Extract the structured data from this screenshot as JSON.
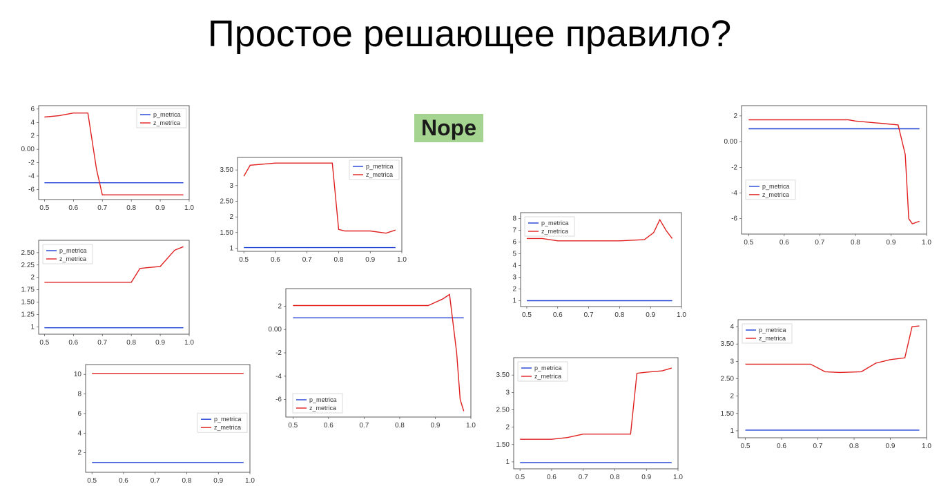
{
  "title": "Простое решающее правило?",
  "nope": "Nope",
  "legend": {
    "p": "p_metrica",
    "z": "z_metrica"
  },
  "x_ticks": [
    0.5,
    0.6,
    0.7,
    0.8,
    0.9,
    1.0
  ],
  "chart_data": [
    {
      "id": "c1",
      "type": "line",
      "pos": [
        12,
        145,
        270,
        170
      ],
      "x": [
        0.5,
        0.55,
        0.6,
        0.65,
        0.68,
        0.7,
        0.72,
        0.8,
        0.9,
        0.98
      ],
      "series": [
        {
          "name": "p_metrica",
          "values": [
            -5.0,
            -5.0,
            -5.0,
            -5.0,
            -5.0,
            -5.0,
            -5.0,
            -5.0,
            -5.0,
            -5.0
          ]
        },
        {
          "name": "z_metrica",
          "values": [
            4.8,
            5.0,
            5.4,
            5.4,
            -3.0,
            -6.8,
            -6.8,
            -6.8,
            -6.8,
            -6.8
          ]
        }
      ],
      "ylim": [
        -7.5,
        6.5
      ],
      "yticks": [
        -6,
        -4,
        -2,
        0,
        2,
        4,
        6
      ],
      "legend_pos": "top-right-inside"
    },
    {
      "id": "c2",
      "type": "line",
      "pos": [
        12,
        340,
        270,
        170
      ],
      "x": [
        0.5,
        0.6,
        0.7,
        0.75,
        0.8,
        0.83,
        0.86,
        0.9,
        0.95,
        0.98
      ],
      "series": [
        {
          "name": "p_metrica",
          "values": [
            0.98,
            0.98,
            0.98,
            0.98,
            0.98,
            0.98,
            0.98,
            0.98,
            0.98,
            0.98
          ]
        },
        {
          "name": "z_metrica",
          "values": [
            1.9,
            1.9,
            1.9,
            1.9,
            1.9,
            2.18,
            2.2,
            2.22,
            2.55,
            2.62
          ]
        }
      ],
      "ylim": [
        0.85,
        2.75
      ],
      "yticks": [
        1.0,
        1.25,
        1.5,
        1.75,
        2.0,
        2.25,
        2.5
      ],
      "legend_pos": "top-left"
    },
    {
      "id": "c3",
      "type": "line",
      "pos": [
        80,
        520,
        290,
        190
      ],
      "x": [
        0.5,
        0.6,
        0.7,
        0.8,
        0.9,
        0.98
      ],
      "series": [
        {
          "name": "p_metrica",
          "values": [
            1.0,
            1.0,
            1.0,
            1.0,
            1.0,
            1.0
          ]
        },
        {
          "name": "z_metrica",
          "values": [
            10.1,
            10.1,
            10.1,
            10.1,
            10.1,
            10.1
          ]
        }
      ],
      "ylim": [
        0,
        11
      ],
      "yticks": [
        2,
        4,
        6,
        8,
        10
      ],
      "legend_pos": "right-mid"
    },
    {
      "id": "c4",
      "type": "line",
      "pos": [
        300,
        220,
        290,
        170
      ],
      "x": [
        0.5,
        0.52,
        0.6,
        0.7,
        0.78,
        0.8,
        0.82,
        0.9,
        0.95,
        0.98
      ],
      "series": [
        {
          "name": "p_metrica",
          "values": [
            1.02,
            1.02,
            1.02,
            1.02,
            1.02,
            1.02,
            1.02,
            1.02,
            1.02,
            1.02
          ]
        },
        {
          "name": "z_metrica",
          "values": [
            3.3,
            3.65,
            3.72,
            3.72,
            3.72,
            1.6,
            1.55,
            1.55,
            1.48,
            1.58
          ]
        }
      ],
      "ylim": [
        0.9,
        3.9
      ],
      "yticks": [
        1.0,
        1.5,
        2.0,
        2.5,
        3.0,
        3.5
      ],
      "legend_pos": "top-right-inside"
    },
    {
      "id": "c5",
      "type": "line",
      "pos": [
        370,
        410,
        320,
        220
      ],
      "x": [
        0.5,
        0.6,
        0.7,
        0.8,
        0.88,
        0.92,
        0.94,
        0.96,
        0.97,
        0.98
      ],
      "series": [
        {
          "name": "p_metrica",
          "values": [
            1.0,
            1.0,
            1.0,
            1.0,
            1.0,
            1.0,
            1.0,
            1.0,
            1.0,
            1.0
          ]
        },
        {
          "name": "z_metrica",
          "values": [
            2.05,
            2.05,
            2.05,
            2.05,
            2.05,
            2.6,
            3.0,
            -2.0,
            -6.0,
            -7.0
          ]
        }
      ],
      "ylim": [
        -7.5,
        3.5
      ],
      "yticks": [
        -6,
        -4,
        -2,
        0,
        2
      ],
      "legend_pos": "bottom-left"
    },
    {
      "id": "c6",
      "type": "line",
      "pos": [
        710,
        300,
        285,
        170
      ],
      "x": [
        0.5,
        0.55,
        0.6,
        0.7,
        0.8,
        0.88,
        0.91,
        0.93,
        0.95,
        0.97
      ],
      "series": [
        {
          "name": "p_metrica",
          "values": [
            1.0,
            1.0,
            1.0,
            1.0,
            1.0,
            1.0,
            1.0,
            1.0,
            1.0,
            1.0
          ]
        },
        {
          "name": "z_metrica",
          "values": [
            6.3,
            6.3,
            6.1,
            6.1,
            6.1,
            6.2,
            6.8,
            7.9,
            7.0,
            6.3
          ]
        }
      ],
      "ylim": [
        0.5,
        8.5
      ],
      "yticks": [
        1,
        2,
        3,
        4,
        5,
        6,
        7,
        8
      ],
      "legend_pos": "top-left"
    },
    {
      "id": "c7",
      "type": "line",
      "pos": [
        700,
        510,
        290,
        195
      ],
      "x": [
        0.5,
        0.6,
        0.65,
        0.7,
        0.8,
        0.85,
        0.87,
        0.9,
        0.95,
        0.98
      ],
      "series": [
        {
          "name": "p_metrica",
          "values": [
            0.98,
            0.98,
            0.98,
            0.98,
            0.98,
            0.98,
            0.98,
            0.98,
            0.98,
            0.98
          ]
        },
        {
          "name": "z_metrica",
          "values": [
            1.65,
            1.65,
            1.7,
            1.8,
            1.8,
            1.8,
            3.55,
            3.58,
            3.62,
            3.7
          ]
        }
      ],
      "ylim": [
        0.8,
        4.0
      ],
      "yticks": [
        1.0,
        1.5,
        2.0,
        2.5,
        3.0,
        3.5
      ],
      "legend_pos": "top-left"
    },
    {
      "id": "c8",
      "type": "line",
      "pos": [
        1030,
        145,
        320,
        220
      ],
      "x": [
        0.5,
        0.6,
        0.7,
        0.78,
        0.8,
        0.88,
        0.92,
        0.94,
        0.95,
        0.96,
        0.98
      ],
      "series": [
        {
          "name": "p_metrica",
          "values": [
            1.0,
            1.0,
            1.0,
            1.0,
            1.0,
            1.0,
            1.0,
            1.0,
            1.0,
            1.0,
            1.0
          ]
        },
        {
          "name": "z_metrica",
          "values": [
            1.7,
            1.7,
            1.7,
            1.7,
            1.6,
            1.4,
            1.3,
            -1.0,
            -6.0,
            -6.4,
            -6.2
          ]
        }
      ],
      "ylim": [
        -7.2,
        2.8
      ],
      "yticks": [
        -6,
        -4,
        -2,
        0,
        2
      ],
      "legend_pos": "left-mid"
    },
    {
      "id": "c9",
      "type": "line",
      "pos": [
        1025,
        455,
        325,
        205
      ],
      "x": [
        0.5,
        0.6,
        0.68,
        0.72,
        0.76,
        0.82,
        0.86,
        0.9,
        0.94,
        0.96,
        0.98
      ],
      "series": [
        {
          "name": "p_metrica",
          "values": [
            1.02,
            1.02,
            1.02,
            1.02,
            1.02,
            1.02,
            1.02,
            1.02,
            1.02,
            1.02,
            1.02
          ]
        },
        {
          "name": "z_metrica",
          "values": [
            2.92,
            2.92,
            2.92,
            2.7,
            2.68,
            2.7,
            2.95,
            3.05,
            3.1,
            4.0,
            4.02
          ]
        }
      ],
      "ylim": [
        0.8,
        4.2
      ],
      "yticks": [
        1.0,
        1.5,
        2.0,
        2.5,
        3.0,
        3.5,
        4.0
      ],
      "legend_pos": "top-left"
    }
  ]
}
